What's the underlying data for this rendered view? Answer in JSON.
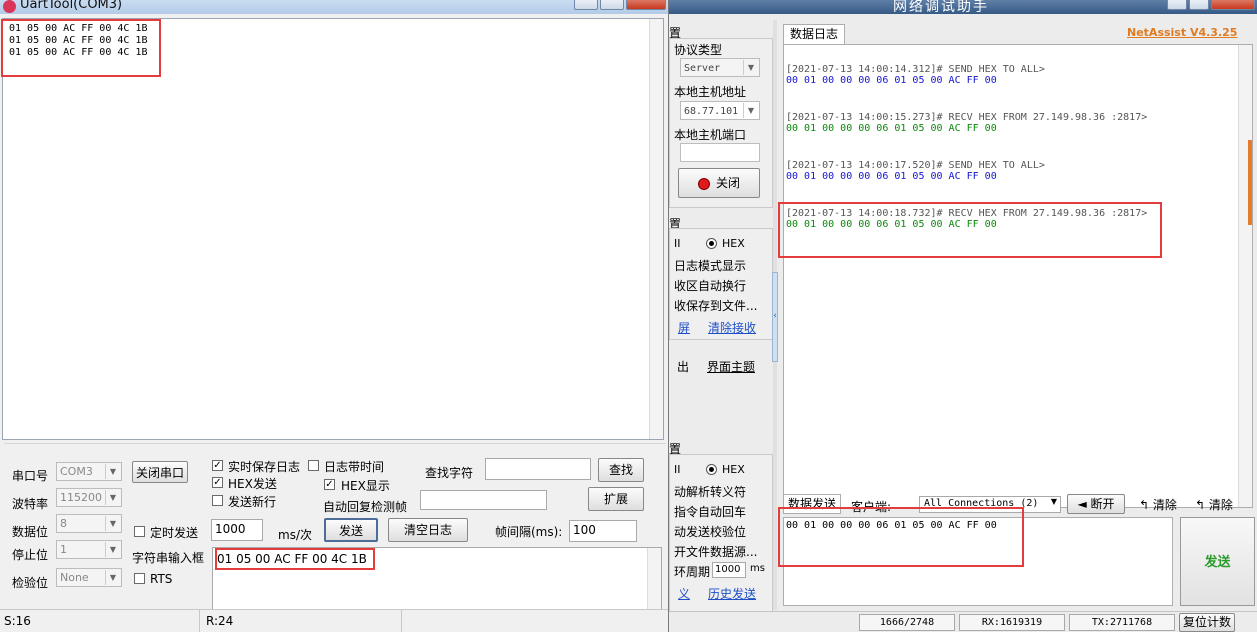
{
  "uart": {
    "title": "UartTool(COM3)",
    "recv_lines": [
      "01 05 00 AC FF 00 4C 1B",
      "01 05 00 AC FF 00 4C 1B",
      "01 05 00 AC FF 00 4C 1B"
    ],
    "port_label": "串口号",
    "port_value": "COM3",
    "baud_label": "波特率",
    "baud_value": "115200",
    "databits_label": "数据位",
    "databits_value": "8",
    "stopbits_label": "停止位",
    "stopbits_value": "1",
    "parity_label": "检验位",
    "parity_value": "None",
    "close_port_label": "关闭串口",
    "realtime_save_label": "实时保存日志",
    "log_time_label": "日志带时间",
    "hex_send_label": "HEX发送",
    "hex_display_label": "HEX显示",
    "send_newline_label": "发送新行",
    "auto_reply_label": "自动回复检测帧",
    "find_char_label": "查找字符",
    "find_button_label": "查找",
    "expand_button_label": "扩展",
    "timed_send_label": "定时发送",
    "interval_value": "1000",
    "interval_unit": "ms/次",
    "send_button_label": "发送",
    "clear_log_label": "清空日志",
    "frame_interval_label": "帧间隔(ms):",
    "frame_interval_value": "100",
    "string_input_label": "字符串输入框",
    "rts_label": "RTS",
    "input_value": "01 05 00 AC FF 00 4C 1B",
    "status_s": "S:16",
    "status_r": "R:24"
  },
  "net": {
    "title": "网络调试助手",
    "version": "NetAssist V4.3.25",
    "left": {
      "section1": "置",
      "protocol_label": "协议类型",
      "protocol_value": "Server",
      "host_label": "本地主机地址",
      "host_value": "68.77.101",
      "port_label": "本地主机端口",
      "close_button_label": "关闭",
      "section2": "置",
      "ascii_label": "II",
      "hex_label": "HEX",
      "opt_log_mode": "日志模式显示",
      "opt_auto_wrap": "收区自动换行",
      "opt_save_file": "收保存到文件...",
      "link_screen": "屏",
      "link_clear_recv": "清除接收",
      "link_out": "出",
      "link_theme": "界面主题",
      "section3": "置",
      "ascii2_label": "II",
      "hex2_label": "HEX",
      "opt_escape": "动解析转义符",
      "opt_cr": "指令自动回车",
      "opt_checksum": "动发送校验位",
      "opt_file_src": "开文件数据源...",
      "cycle_label": "环周期",
      "cycle_value": "1000",
      "cycle_unit": "ms",
      "link_def": "义",
      "link_history": "历史发送"
    },
    "log_tab": "数据日志",
    "log_entries": [
      {
        "head": "[2021-07-13 14:00:14.312]# SEND HEX TO ALL>",
        "data": "00 01 00 00 00 06 01 05 00 AC FF 00",
        "dir": "send"
      },
      {
        "head": "[2021-07-13 14:00:15.273]# RECV HEX FROM 27.149.98.36 :2817>",
        "data": "00 01 00 00 00 06 01 05 00 AC FF 00",
        "dir": "recv"
      },
      {
        "head": "[2021-07-13 14:00:17.520]# SEND HEX TO ALL>",
        "data": "00 01 00 00 00 06 01 05 00 AC FF 00",
        "dir": "send"
      },
      {
        "head": "[2021-07-13 14:00:18.732]# RECV HEX FROM 27.149.98.36 :2817>",
        "data": "00 01 00 00 00 06 01 05 00 AC FF 00",
        "dir": "recv"
      }
    ],
    "send_tab": "数据发送",
    "client_label": "客户端:",
    "client_value": "All Connections (2)",
    "disconnect_label": "断开",
    "clear1_label": "清除",
    "clear2_label": "清除",
    "send_text": "00 01 00 00 00 06 01 05 00 AC FF 00",
    "send_button_label": "发送",
    "status_count": "1666/2748",
    "status_rx": "RX:1619319",
    "status_tx": "TX:2711768",
    "reset_label": "复位计数"
  },
  "colors": {
    "send_blue": "#1515d6",
    "recv_green": "#0b8a0b",
    "highlight_red": "#e23c3c",
    "version_orange": "#e07b22"
  }
}
